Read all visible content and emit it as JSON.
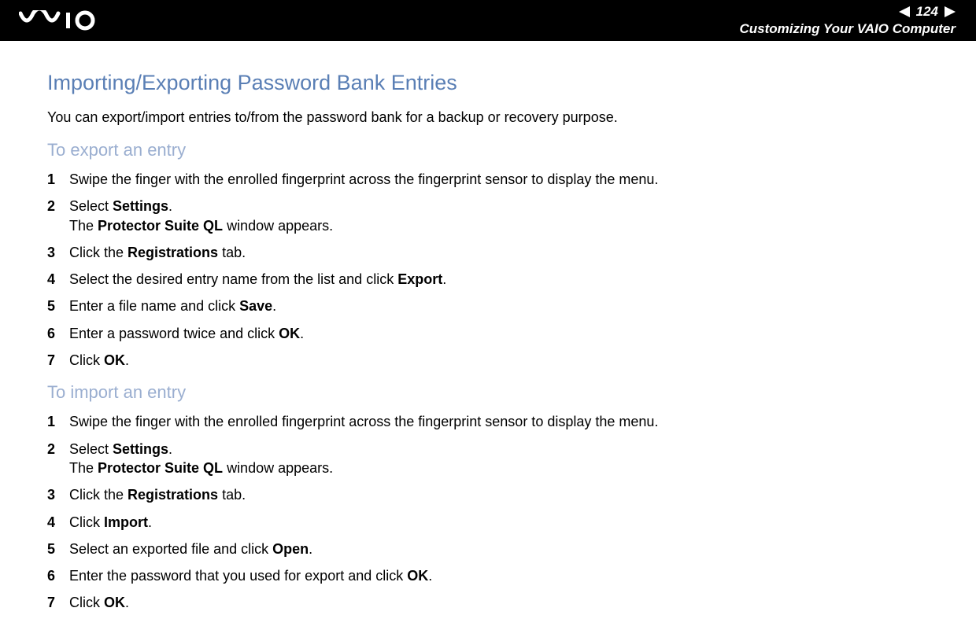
{
  "header": {
    "page_number": "124",
    "subtitle": "Customizing Your VAIO Computer"
  },
  "content": {
    "title": "Importing/Exporting Password Bank Entries",
    "intro": "You can export/import entries to/from the password bank for a backup or recovery purpose.",
    "sections": [
      {
        "heading": "To export an entry",
        "steps": [
          {
            "num": "1",
            "parts": [
              {
                "t": "Swipe the finger with the enrolled fingerprint across the fingerprint sensor to display the menu.",
                "b": false
              }
            ]
          },
          {
            "num": "2",
            "parts": [
              {
                "t": "Select ",
                "b": false
              },
              {
                "t": "Settings",
                "b": true
              },
              {
                "t": ".",
                "b": false
              }
            ],
            "sub": [
              {
                "t": "The ",
                "b": false
              },
              {
                "t": "Protector Suite QL",
                "b": true
              },
              {
                "t": " window appears.",
                "b": false
              }
            ]
          },
          {
            "num": "3",
            "parts": [
              {
                "t": "Click the ",
                "b": false
              },
              {
                "t": "Registrations",
                "b": true
              },
              {
                "t": " tab.",
                "b": false
              }
            ]
          },
          {
            "num": "4",
            "parts": [
              {
                "t": "Select the desired entry name from the list and click ",
                "b": false
              },
              {
                "t": "Export",
                "b": true
              },
              {
                "t": ".",
                "b": false
              }
            ]
          },
          {
            "num": "5",
            "parts": [
              {
                "t": "Enter a file name and click ",
                "b": false
              },
              {
                "t": "Save",
                "b": true
              },
              {
                "t": ".",
                "b": false
              }
            ]
          },
          {
            "num": "6",
            "parts": [
              {
                "t": "Enter a password twice and click ",
                "b": false
              },
              {
                "t": "OK",
                "b": true
              },
              {
                "t": ".",
                "b": false
              }
            ]
          },
          {
            "num": "7",
            "parts": [
              {
                "t": "Click ",
                "b": false
              },
              {
                "t": "OK",
                "b": true
              },
              {
                "t": ".",
                "b": false
              }
            ]
          }
        ]
      },
      {
        "heading": "To import an entry",
        "steps": [
          {
            "num": "1",
            "parts": [
              {
                "t": "Swipe the finger with the enrolled fingerprint across the fingerprint sensor to display the menu.",
                "b": false
              }
            ]
          },
          {
            "num": "2",
            "parts": [
              {
                "t": "Select ",
                "b": false
              },
              {
                "t": "Settings",
                "b": true
              },
              {
                "t": ".",
                "b": false
              }
            ],
            "sub": [
              {
                "t": "The ",
                "b": false
              },
              {
                "t": "Protector Suite QL",
                "b": true
              },
              {
                "t": " window appears.",
                "b": false
              }
            ]
          },
          {
            "num": "3",
            "parts": [
              {
                "t": "Click the ",
                "b": false
              },
              {
                "t": "Registrations",
                "b": true
              },
              {
                "t": " tab.",
                "b": false
              }
            ]
          },
          {
            "num": "4",
            "parts": [
              {
                "t": "Click ",
                "b": false
              },
              {
                "t": "Import",
                "b": true
              },
              {
                "t": ".",
                "b": false
              }
            ]
          },
          {
            "num": "5",
            "parts": [
              {
                "t": "Select an exported file and click ",
                "b": false
              },
              {
                "t": "Open",
                "b": true
              },
              {
                "t": ".",
                "b": false
              }
            ]
          },
          {
            "num": "6",
            "parts": [
              {
                "t": "Enter the password that you used for export and click ",
                "b": false
              },
              {
                "t": "OK",
                "b": true
              },
              {
                "t": ".",
                "b": false
              }
            ]
          },
          {
            "num": "7",
            "parts": [
              {
                "t": "Click ",
                "b": false
              },
              {
                "t": "OK",
                "b": true
              },
              {
                "t": ".",
                "b": false
              }
            ]
          }
        ]
      }
    ]
  }
}
